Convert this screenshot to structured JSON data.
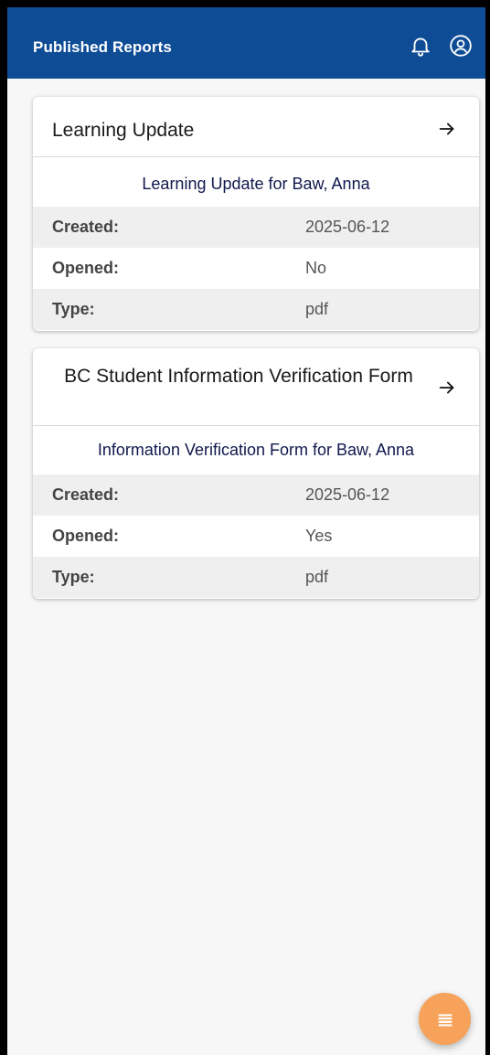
{
  "header": {
    "title": "Published Reports",
    "icons": [
      "bell-icon",
      "user-circle-icon"
    ]
  },
  "reports": [
    {
      "title": "Learning Update",
      "subtitle": "Learning Update for Baw, Anna",
      "created_label": "Created:",
      "created_value": "2025-06-12",
      "opened_label": "Opened:",
      "opened_value": "No",
      "type_label": "Type:",
      "type_value": "pdf"
    },
    {
      "title": "BC Student Information Verification Form",
      "subtitle": "Information Verification Form for Baw, Anna",
      "created_label": "Created:",
      "created_value": "2025-06-12",
      "opened_label": "Opened:",
      "opened_value": "Yes",
      "type_label": "Type:",
      "type_value": "pdf"
    }
  ],
  "fab": {
    "icon": "menu-icon"
  },
  "colors": {
    "header_bg": "#0f4c96",
    "fab_bg": "#f6a25a"
  }
}
